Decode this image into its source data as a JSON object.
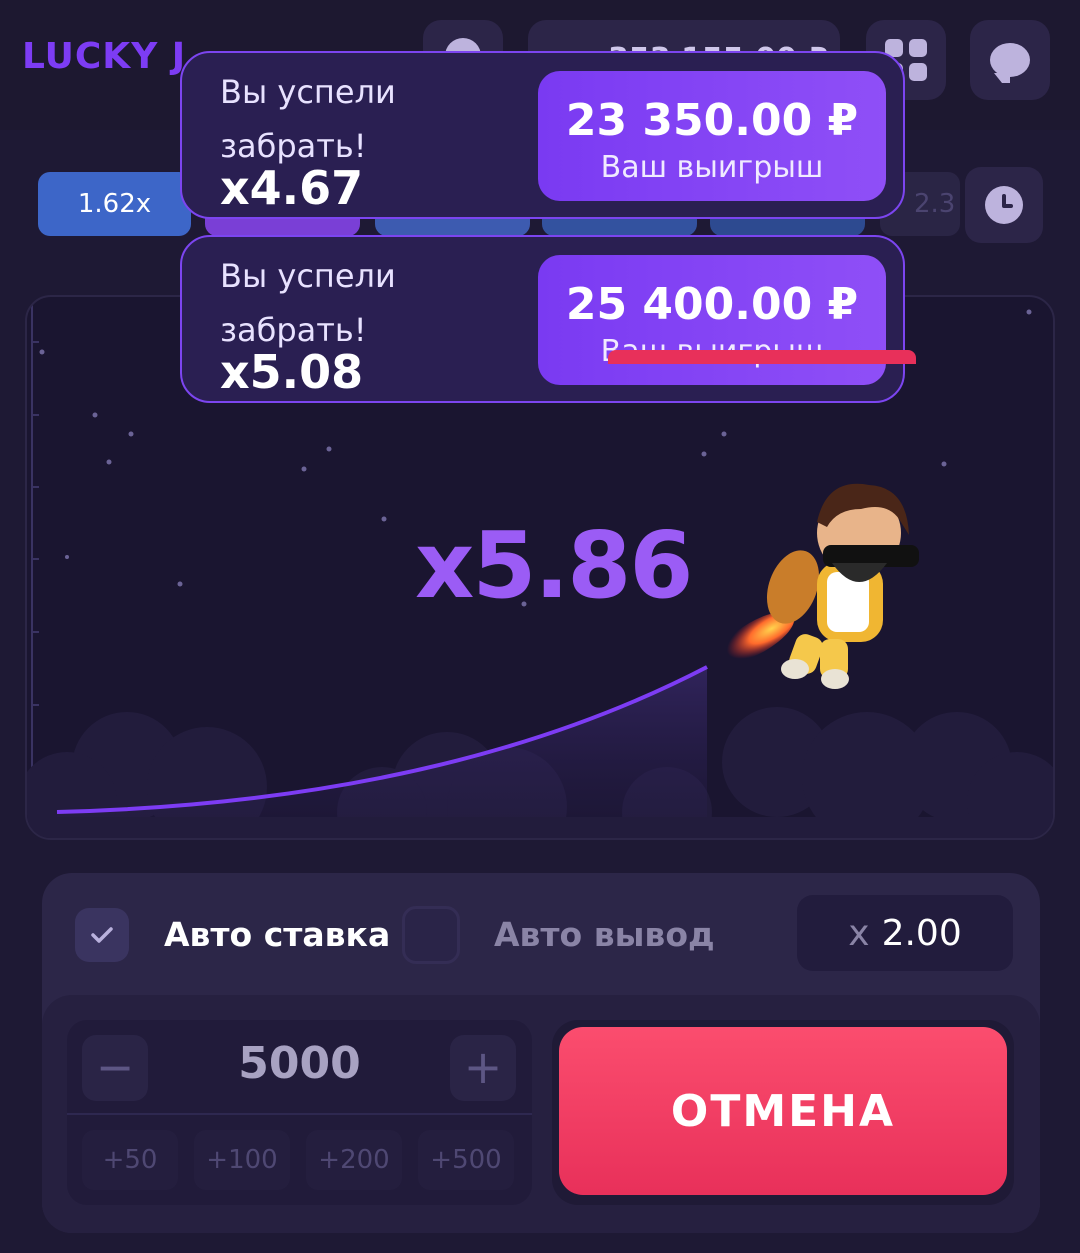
{
  "header": {
    "logo": "LUCKY J",
    "balance": "353 155.00 ₽"
  },
  "history": {
    "chips": [
      "1.62x",
      "",
      "",
      "",
      "",
      "2.3"
    ]
  },
  "game": {
    "multiplier": "x5.86"
  },
  "notifications": [
    {
      "message": "Вы успели забрать!",
      "multiplier": "x4.67",
      "amount": "23 350.00 ₽",
      "label": "Ваш выигрыш"
    },
    {
      "message": "Вы успели забрать!",
      "multiplier": "x5.08",
      "amount": "25 400.00 ₽",
      "label": "Ваш выигрыш"
    }
  ],
  "bet_panel": {
    "auto_bet_label": "Авто ставка",
    "auto_bet_checked": true,
    "auto_cashout_label": "Авто вывод",
    "auto_cashout_checked": false,
    "cashout_prefix": "x",
    "cashout_value": "2.00",
    "stake_value": "5000",
    "minus": "−",
    "plus": "+",
    "quick_amounts": [
      "+50",
      "+100",
      "+200",
      "+500"
    ],
    "cancel_label": "ОТМЕНА"
  },
  "colors": {
    "accent": "#7d3cf4",
    "multiplier": "#9b5cf5",
    "cancel": "#f0416a",
    "background": "#1e1934"
  }
}
